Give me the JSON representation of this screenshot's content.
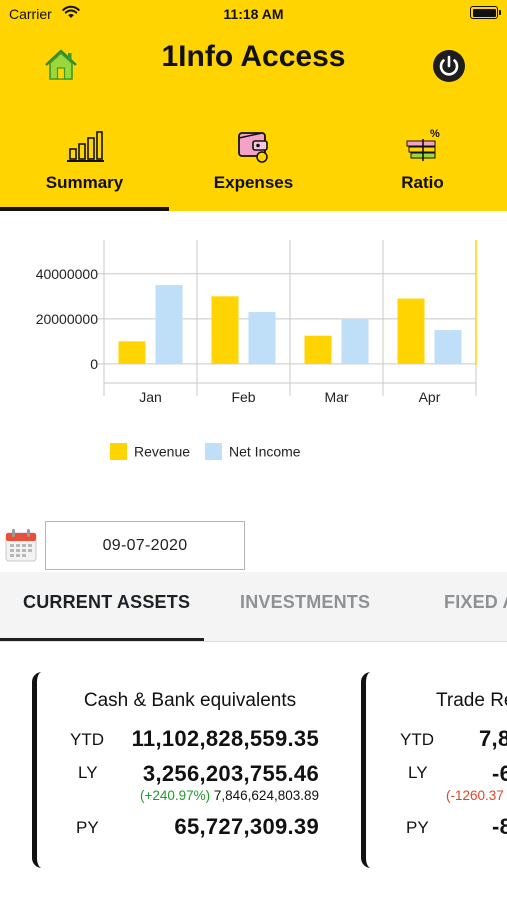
{
  "status_bar": {
    "carrier": "Carrier",
    "time": "11:18 AM"
  },
  "header": {
    "title": "1Info Access",
    "home_icon": "home-icon",
    "power_icon": "power-icon",
    "tabs": [
      {
        "label": "Summary",
        "icon": "bar-chart-icon",
        "active": true
      },
      {
        "label": "Expenses",
        "icon": "wallet-icon",
        "active": false
      },
      {
        "label": "Ratio",
        "icon": "ratio-percent-icon",
        "active": false
      }
    ]
  },
  "chart_data": {
    "type": "bar",
    "categories": [
      "Jan",
      "Feb",
      "Mar",
      "Apr"
    ],
    "series": [
      {
        "name": "Revenue",
        "color": "#ffd400",
        "values": [
          10000000,
          30000000,
          12500000,
          29000000
        ]
      },
      {
        "name": "Net Income",
        "color": "#bfdef8",
        "values": [
          35000000,
          23000000,
          20000000,
          15000000
        ]
      }
    ],
    "yticks": [
      "0",
      "20000000",
      "40000000"
    ],
    "ylim": [
      -8500000,
      55000000
    ],
    "grid": true,
    "legend_position": "bottom"
  },
  "date": {
    "value": "09-07-2020",
    "icon": "calendar-icon"
  },
  "section_tabs": [
    "CURRENT ASSETS",
    "INVESTMENTS",
    "FIXED A"
  ],
  "cards": [
    {
      "title": "Cash & Bank equivalents",
      "ytd_label": "YTD",
      "ytd": "11,102,828,559.35",
      "ly_label": "LY",
      "ly": "3,256,203,755.46",
      "ly_change": "(+240.97%)",
      "ly_compare": "7,846,624,803.89",
      "py_label": "PY",
      "py": "65,727,309.39"
    },
    {
      "title": "Trade Re",
      "ytd_label": "YTD",
      "ytd": "7,8",
      "ly_label": "LY",
      "ly": "-6",
      "ly_change": "(-1260.37",
      "ly_compare": "",
      "py_label": "PY",
      "py": "-8"
    }
  ]
}
